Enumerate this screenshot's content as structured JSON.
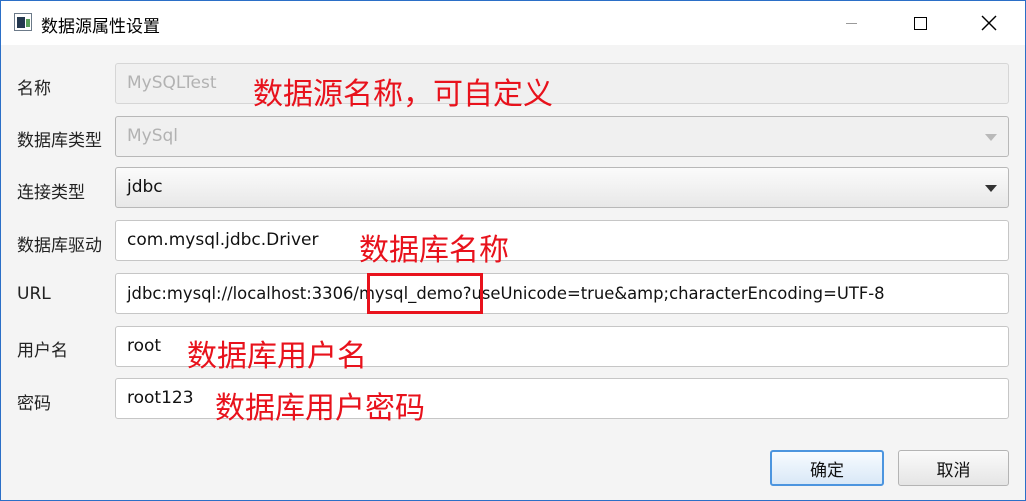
{
  "window": {
    "title": "数据源属性设置"
  },
  "form": {
    "name": {
      "label": "名称",
      "value": "MySQLTest",
      "note": "数据源名称，可自定义"
    },
    "db_type": {
      "label": "数据库类型",
      "value": "MySql"
    },
    "conn_type": {
      "label": "连接类型",
      "value": "jdbc"
    },
    "driver": {
      "label": "数据库驱动",
      "value": "com.mysql.jdbc.Driver",
      "note": "数据库名称"
    },
    "url": {
      "label": "URL",
      "value": "jdbc:mysql://localhost:3306/mysql_demo?useUnicode=true&amp;characterEncoding=UTF-8"
    },
    "user": {
      "label": "用户名",
      "value": "root",
      "note": "数据库用户名"
    },
    "password": {
      "label": "密码",
      "value": "root123",
      "note": "数据库用户密码"
    }
  },
  "buttons": {
    "ok": "确定",
    "cancel": "取消"
  },
  "colors": {
    "annotation": "#e8121c",
    "window_border": "#2b6fc7",
    "default_button_border": "#4c95df"
  }
}
